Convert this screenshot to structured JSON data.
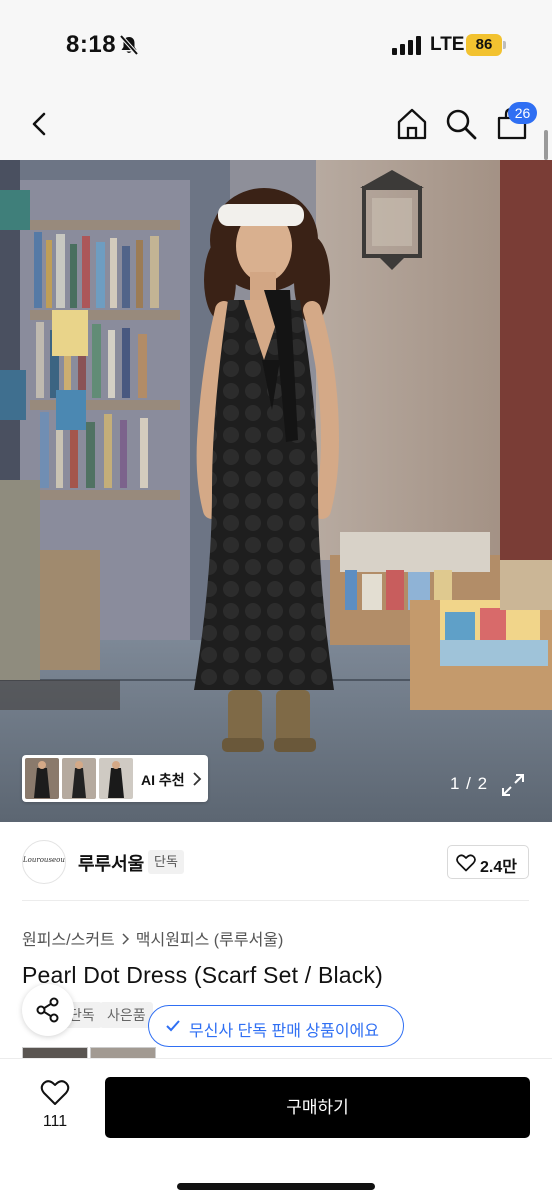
{
  "status_bar": {
    "time": "8:18",
    "network": "LTE",
    "battery": "86"
  },
  "header": {
    "cart_count": "26"
  },
  "gallery": {
    "ai_label": "AI 추천",
    "counter": "1 / 2"
  },
  "brand": {
    "logo_text": "Lourouseoul",
    "name": "루루서울",
    "exclusive_tag": "단독",
    "likes": "2.4만"
  },
  "breadcrumb": {
    "category": "원피스/스커트",
    "subcategory": "맥시원피스 (루루서울)"
  },
  "product": {
    "title": "Pearl Dot Dress (Scarf Set / Black)",
    "tags": [
      "단독",
      "사은품"
    ],
    "exclusive_notice": "무신사 단독 판매 상품이에요"
  },
  "bottom_bar": {
    "wish_count": "111",
    "buy_label": "구매하기"
  },
  "colors": {
    "accent": "#2f6ff3",
    "battery": "#f2c230",
    "buy_button": "#000000"
  }
}
